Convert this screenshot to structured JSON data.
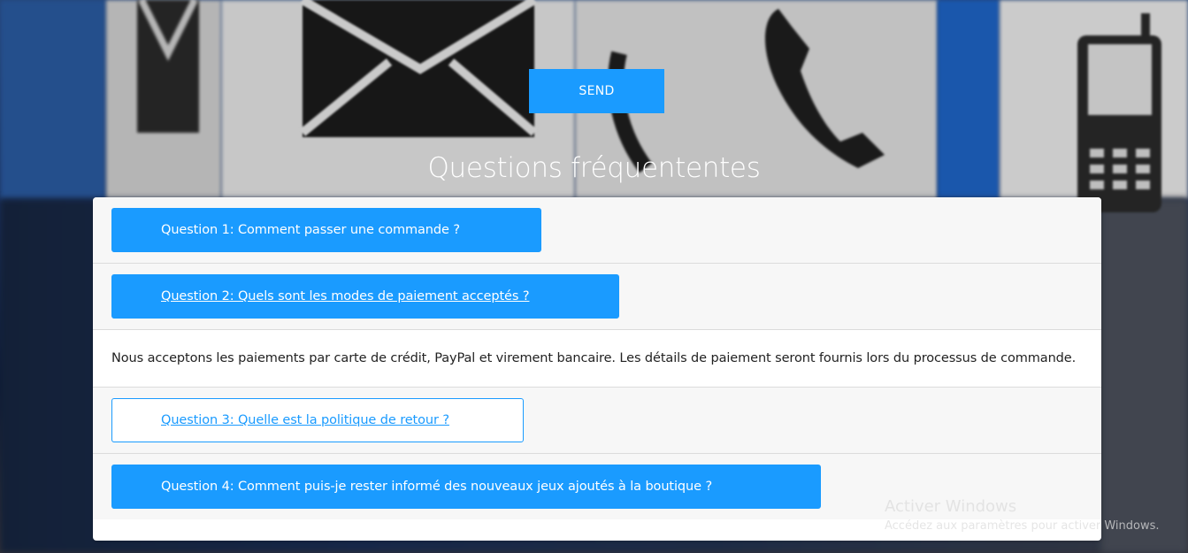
{
  "send_button": {
    "label": "SEND"
  },
  "faq": {
    "title": "Questions fréquententes",
    "items": [
      {
        "question": "Question 1: Comment passer une commande ?",
        "state": "collapsed"
      },
      {
        "question": "Question 2: Quels sont les modes de paiement acceptés ?",
        "state": "expanded",
        "answer": "Nous acceptons les paiements par carte de crédit, PayPal et virement bancaire. Les détails de paiement seront fournis lors du processus de commande."
      },
      {
        "question": "Question 3: Quelle est la politique de retour ?",
        "state": "hover-outline"
      },
      {
        "question": "Question 4: Comment puis-je rester informé des nouveaux jeux ajoutés à la boutique ?",
        "state": "collapsed"
      }
    ]
  },
  "windows_watermark": {
    "line1": "Activer Windows",
    "line2": "Accédez aux paramètres pour activer Windows."
  },
  "colors": {
    "accent": "#1a9bff",
    "card_bg": "#ffffff",
    "header_bg": "#f7f7f7"
  },
  "background_icons": [
    "envelope-icon",
    "telephone-icon",
    "mobile-phone-icon"
  ]
}
